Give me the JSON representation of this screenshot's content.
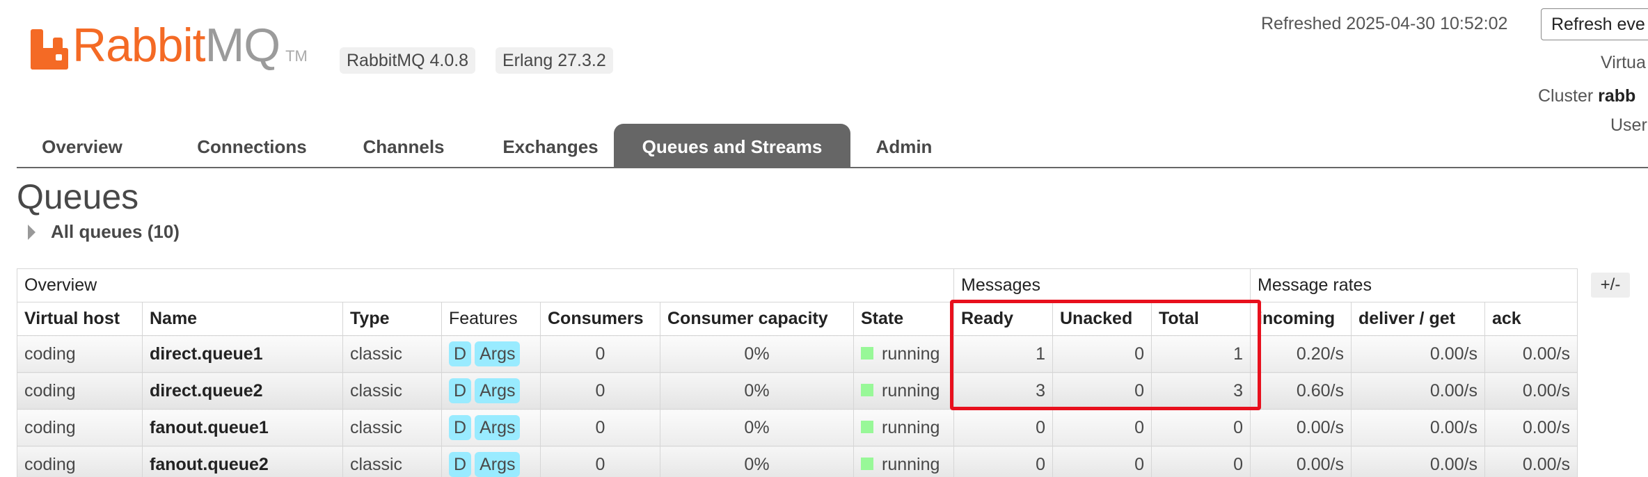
{
  "header": {
    "logo_rabbit": "Rabbit",
    "logo_mq": "MQ",
    "logo_tm": "TM",
    "rabbitmq_version": "RabbitMQ 4.0.8",
    "erlang_version": "Erlang 27.3.2",
    "refreshed": "Refreshed 2025-04-30 10:52:02",
    "refresh_button": "Refresh eve",
    "virtual_host_label": "Virtua",
    "cluster_label": "Cluster",
    "cluster_value": "rabb",
    "user_label": "User"
  },
  "nav": {
    "items": [
      {
        "label": "Overview"
      },
      {
        "label": "Connections"
      },
      {
        "label": "Channels"
      },
      {
        "label": "Exchanges"
      },
      {
        "label": "Queues and Streams",
        "active": true
      },
      {
        "label": "Admin"
      }
    ]
  },
  "page": {
    "title": "Queues",
    "section_label": "All queues (10)",
    "plus_minus": "+/-"
  },
  "table": {
    "groups": [
      "Overview",
      "Messages",
      "Message rates"
    ],
    "columns": [
      "Virtual host",
      "Name",
      "Type",
      "Features",
      "Consumers",
      "Consumer capacity",
      "State",
      "Ready",
      "Unacked",
      "Total",
      "incoming",
      "deliver / get",
      "ack"
    ],
    "rows": [
      {
        "vhost": "coding",
        "name": "direct.queue1",
        "type": "classic",
        "feat_d": "D",
        "feat_args": "Args",
        "consumers": "0",
        "capacity": "0%",
        "state": "running",
        "ready": "1",
        "unacked": "0",
        "total": "1",
        "incoming": "0.20/s",
        "deliver": "0.00/s",
        "ack": "0.00/s"
      },
      {
        "vhost": "coding",
        "name": "direct.queue2",
        "type": "classic",
        "feat_d": "D",
        "feat_args": "Args",
        "consumers": "0",
        "capacity": "0%",
        "state": "running",
        "ready": "3",
        "unacked": "0",
        "total": "3",
        "incoming": "0.60/s",
        "deliver": "0.00/s",
        "ack": "0.00/s"
      },
      {
        "vhost": "coding",
        "name": "fanout.queue1",
        "type": "classic",
        "feat_d": "D",
        "feat_args": "Args",
        "consumers": "0",
        "capacity": "0%",
        "state": "running",
        "ready": "0",
        "unacked": "0",
        "total": "0",
        "incoming": "0.00/s",
        "deliver": "0.00/s",
        "ack": "0.00/s"
      },
      {
        "vhost": "coding",
        "name": "fanout.queue2",
        "type": "classic",
        "feat_d": "D",
        "feat_args": "Args",
        "consumers": "0",
        "capacity": "0%",
        "state": "running",
        "ready": "0",
        "unacked": "0",
        "total": "0",
        "incoming": "0.00/s",
        "deliver": "0.00/s",
        "ack": "0.00/s"
      }
    ]
  },
  "colors": {
    "brand_orange": "#f46a25",
    "nav_active_bg": "#666666",
    "feature_badge": "#99ebff",
    "state_running": "#98f898",
    "highlight_box": "#e8101d"
  }
}
